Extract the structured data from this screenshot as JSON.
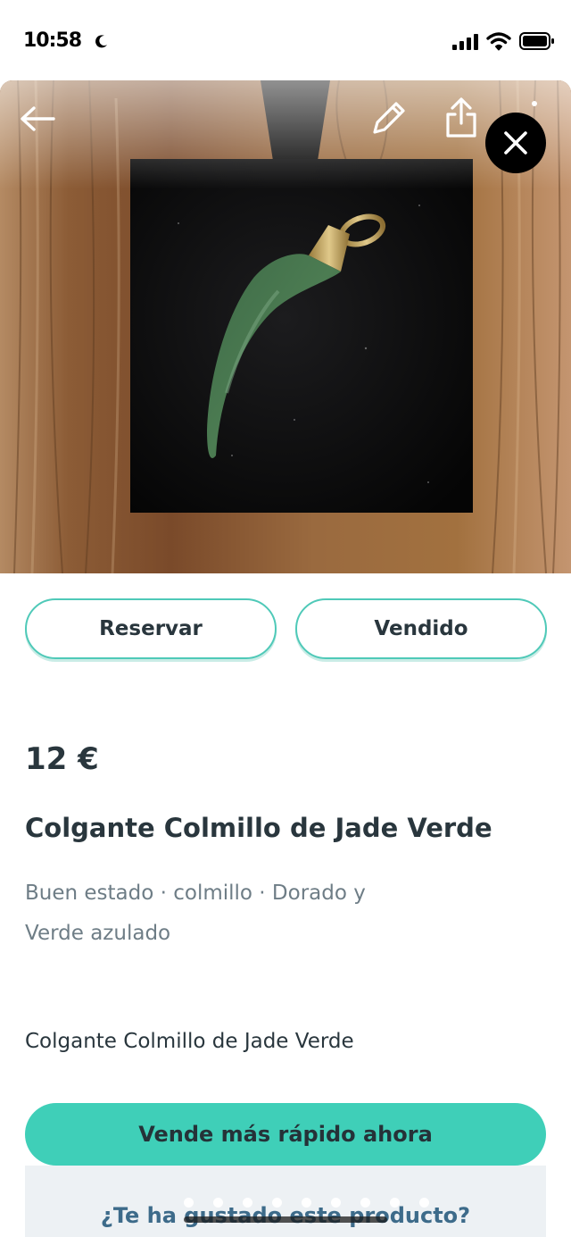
{
  "status_bar": {
    "time": "10:58"
  },
  "photo": {
    "alt": "",
    "page_count": 2,
    "active_page": 1
  },
  "actions": {
    "reserve_label": "Reservar",
    "sold_label": "Vendido"
  },
  "product": {
    "price": "12 €",
    "title": "Colgante Colmillo de Jade Verde",
    "attributes_line1": "Buen estado · colmillo · Dorado y",
    "attributes_line2": "Verde azulado",
    "description": "Colgante Colmillo de Jade Verde"
  },
  "promo": {
    "sell_faster_label": "Vende más rápido ahora",
    "liked_question": "¿Te ha gustado este producto?"
  },
  "colors": {
    "accent": "#3fcfb8",
    "button_border": "#4fc9b8",
    "text_primary": "#29363d",
    "text_secondary": "#6e7d86",
    "link_blue": "#3d6b8a"
  },
  "icons": {
    "back": "arrow-left-icon",
    "edit": "pencil-icon",
    "share": "share-icon",
    "more": "more-vertical-icon",
    "close": "close-icon"
  }
}
